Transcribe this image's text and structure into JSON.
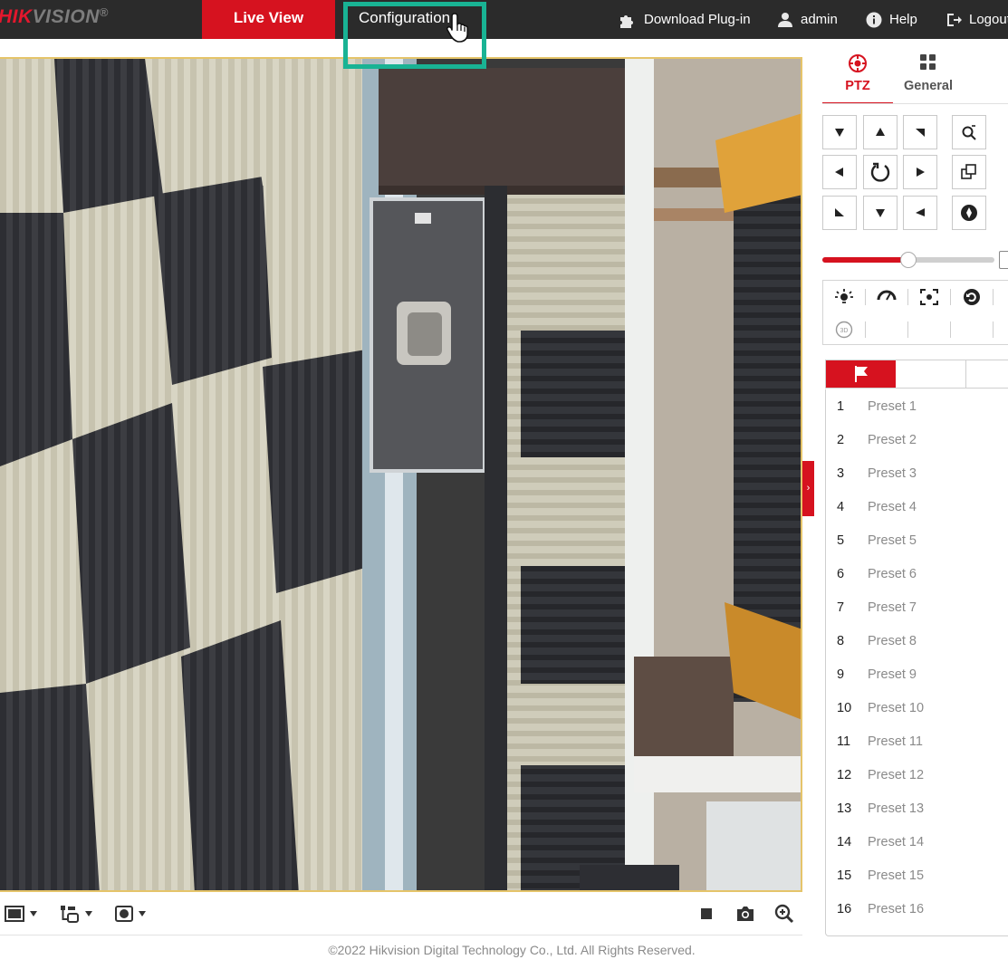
{
  "header": {
    "logo_primary": "HIK",
    "logo_secondary": "VISION",
    "logo_mark": "®",
    "nav": {
      "live_view": "Live View",
      "configuration": "Configuration"
    },
    "links": {
      "download_plugin": "Download Plug-in",
      "user": "admin",
      "help": "Help",
      "logout": "Logout"
    }
  },
  "ptz_panel": {
    "tabs": {
      "ptz": "PTZ",
      "general": "General"
    },
    "speed_level": 0.5,
    "presets": [
      {
        "num": "1",
        "name": "Preset 1"
      },
      {
        "num": "2",
        "name": "Preset 2"
      },
      {
        "num": "3",
        "name": "Preset 3"
      },
      {
        "num": "4",
        "name": "Preset 4"
      },
      {
        "num": "5",
        "name": "Preset 5"
      },
      {
        "num": "6",
        "name": "Preset 6"
      },
      {
        "num": "7",
        "name": "Preset 7"
      },
      {
        "num": "8",
        "name": "Preset 8"
      },
      {
        "num": "9",
        "name": "Preset 9"
      },
      {
        "num": "10",
        "name": "Preset 10"
      },
      {
        "num": "11",
        "name": "Preset 11"
      },
      {
        "num": "12",
        "name": "Preset 12"
      },
      {
        "num": "13",
        "name": "Preset 13"
      },
      {
        "num": "14",
        "name": "Preset 14"
      },
      {
        "num": "15",
        "name": "Preset 15"
      },
      {
        "num": "16",
        "name": "Preset 16"
      }
    ]
  },
  "footer": {
    "copyright": "©2022 Hikvision Digital Technology Co., Ltd. All Rights Reserved."
  },
  "colors": {
    "brand_red": "#d6121f",
    "topbar": "#2b2b2b",
    "highlight": "#19b394"
  },
  "icons": {
    "toolbar_left": [
      "window-layout-icon",
      "stream-type-icon",
      "display-mode-icon"
    ],
    "toolbar_right": [
      "stop-icon",
      "snapshot-icon",
      "zoom-in-icon"
    ]
  }
}
